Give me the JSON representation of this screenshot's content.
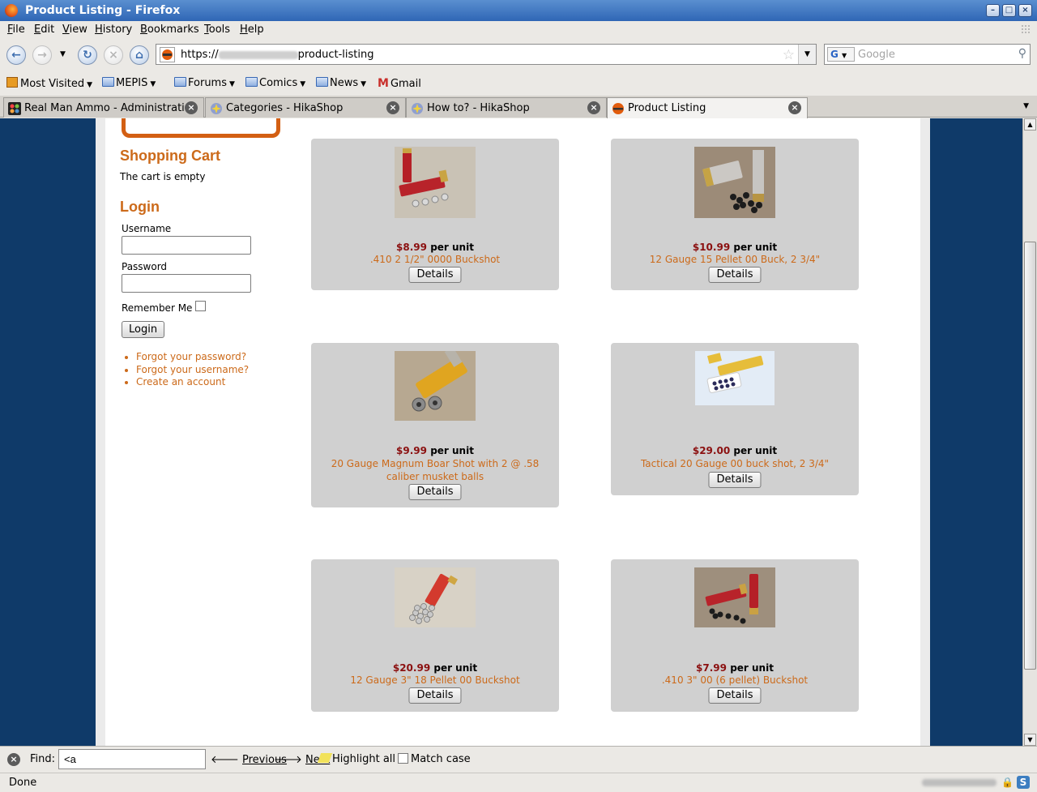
{
  "window": {
    "title": "Product Listing - Firefox"
  },
  "menu": [
    {
      "label": "File",
      "key": "F",
      "rest": "ile"
    },
    {
      "label": "Edit",
      "key": "E",
      "rest": "dit"
    },
    {
      "label": "View",
      "key": "V",
      "rest": "iew"
    },
    {
      "label": "History",
      "key": "H",
      "rest": "istory"
    },
    {
      "label": "Bookmarks",
      "key": "B",
      "rest": "ookmarks"
    },
    {
      "label": "Tools",
      "key": "T",
      "rest": "ools"
    },
    {
      "label": "Help",
      "key": "H",
      "rest": "elp"
    }
  ],
  "navbar": {
    "url_prefix": "https://",
    "url_suffix": "product-listing",
    "search_placeholder": "Google",
    "search_engine_letter": "G"
  },
  "bookmarks": {
    "most_visited": "Most Visited",
    "mepis": "MEPIS",
    "forums": "Forums",
    "comics": "Comics",
    "news": "News",
    "gmail": "Gmail"
  },
  "tabs": [
    {
      "label": "Real Man Ammo - Administration"
    },
    {
      "label": "Categories - HikaShop"
    },
    {
      "label": "How to? - HikaShop"
    },
    {
      "label": "Product Listing"
    }
  ],
  "sidebar": {
    "cart_title": "Shopping Cart",
    "cart_message": "The cart is empty",
    "login_title": "Login",
    "username_label": "Username",
    "password_label": "Password",
    "remember_label": "Remember Me",
    "login_button": "Login",
    "links": [
      "Forgot your password?",
      "Forgot your username?",
      "Create an account"
    ]
  },
  "products": [
    {
      "price": "$8.99",
      "unit": "per unit",
      "name": ".410 2 1/2\" 0000 Buckshot",
      "details": "Details"
    },
    {
      "price": "$10.99",
      "unit": "per unit",
      "name": "12 Gauge 15 Pellet 00 Buck, 2 3/4\"",
      "details": "Details"
    },
    {
      "price": "$9.99",
      "unit": "per unit",
      "name": "20 Gauge Magnum Boar Shot with 2 @ .58 caliber musket balls",
      "details": "Details"
    },
    {
      "price": "$29.00",
      "unit": "per unit",
      "name": "Tactical 20 Gauge 00 buck shot, 2 3/4\"",
      "details": "Details"
    },
    {
      "price": "$20.99",
      "unit": "per unit",
      "name": "12 Gauge 3\" 18 Pellet 00 Buckshot",
      "details": "Details"
    },
    {
      "price": "$7.99",
      "unit": "per unit",
      "name": ".410 3\" 00 (6 pellet) Buckshot",
      "details": "Details"
    }
  ],
  "findbar": {
    "label": "Find:",
    "value": "<a",
    "previous": "Previous",
    "next": "Next",
    "highlight": "Highlight all",
    "match_case": "Match case"
  },
  "status": {
    "text": "Done"
  }
}
